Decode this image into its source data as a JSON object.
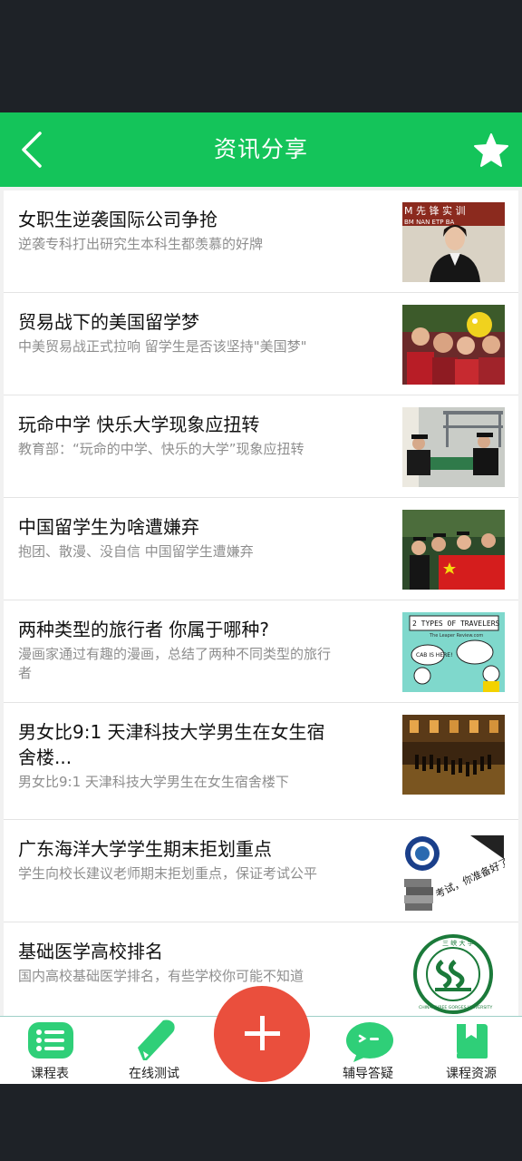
{
  "header": {
    "title": "资讯分享"
  },
  "articles": [
    {
      "title": "女职生逆袭国际公司争抢",
      "summary": "逆袭专科打出研究生本科生都羡慕的好牌"
    },
    {
      "title": "贸易战下的美国留学梦",
      "summary": "中美贸易战正式拉响 留学生是否该坚持\"美国梦\""
    },
    {
      "title": "玩命中学 快乐大学现象应扭转",
      "summary": "教育部：“玩命的中学、快乐的大学”现象应扭转"
    },
    {
      "title": "中国留学生为啥遭嫌弃",
      "summary": "抱团、散漫、没自信 中国留学生遭嫌弃"
    },
    {
      "title": "两种类型的旅行者 你属于哪种?",
      "summary": "漫画家通过有趣的漫画，总结了两种不同类型的旅行者"
    },
    {
      "title": "男女比9:1 天津科技大学男生在女生宿舍楼...",
      "summary": "男女比9:1 天津科技大学男生在女生宿舍楼下"
    },
    {
      "title": "广东海洋大学学生期末拒划重点",
      "summary": "学生向校长建议老师期末拒划重点，保证考试公平"
    },
    {
      "title": "基础医学高校排名",
      "summary": "国内高校基础医学排名，有些学校你可能不知道"
    }
  ],
  "thumb_text": {
    "banner": "M 先 锋 实 训",
    "banner2": "BM NAN    ETP BA",
    "comic_title": "2 TYPES OF TRAVELERS",
    "comic_sub": "The Leaper Review.com",
    "comic_bubble": "CAB IS HERE!",
    "guangdong_text": "考试，你准备好了吗",
    "ctgu_text": "CHINA THREE GORGES UNIVERSITY",
    "ctgu_top": "三 峡 大 学"
  },
  "nav": {
    "schedule": "课程表",
    "test": "在线测试",
    "qa": "辅导答疑",
    "resources": "课程资源"
  },
  "colors": {
    "primary": "#14c45a",
    "fab": "#ea4f3d",
    "nav_icon": "#2fcf78"
  }
}
